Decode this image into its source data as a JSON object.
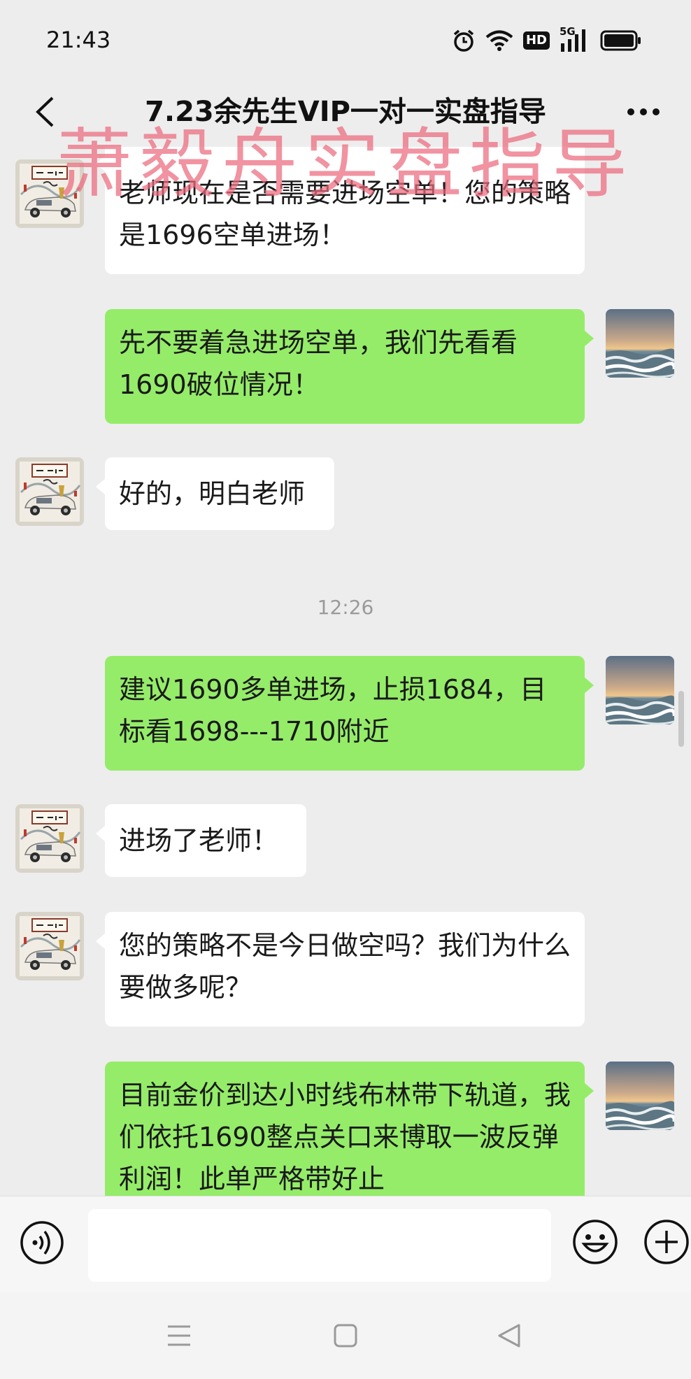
{
  "status_bar": {
    "time": "21:43",
    "icons": [
      "alarm-icon",
      "wifi-icon",
      "hd-icon",
      "signal-5g-icon",
      "battery-icon"
    ],
    "hd_label": "HD",
    "network_label": "5G"
  },
  "header": {
    "title": "7.23余先生VIP一对一实盘指导",
    "back_icon": "back-arrow-icon",
    "more_icon": "more-dots-icon"
  },
  "watermark": {
    "text": "萧毅舟实盘指导",
    "color": "#eb697d"
  },
  "messages": [
    {
      "side": "left",
      "avatar": "car-painting-avatar",
      "text": "老师现在是否需要进场空单！您的策略是1696空单进场！"
    },
    {
      "side": "right",
      "avatar": "sea-sunset-avatar",
      "text": "先不要着急进场空单，我们先看看1690破位情况！"
    },
    {
      "side": "left",
      "avatar": "car-painting-avatar",
      "text": "好的，明白老师"
    },
    {
      "type": "time",
      "text": "12:26"
    },
    {
      "side": "right",
      "avatar": "sea-sunset-avatar",
      "text": "建议1690多单进场，止损1684，目标看1698---1710附近"
    },
    {
      "side": "left",
      "avatar": "car-painting-avatar",
      "text": "进场了老师！"
    },
    {
      "side": "left",
      "avatar": "car-painting-avatar",
      "text": "您的策略不是今日做空吗？我们为什么要做多呢？"
    },
    {
      "side": "right",
      "avatar": "sea-sunset-avatar",
      "text": "目前金价到达小时线布林带下轨道，我们依托1690整点关口来博取一波反弹利润！此单严格带好止"
    }
  ],
  "input_bar": {
    "voice_icon": "voice-icon",
    "input_value": "",
    "emoji_icon": "emoji-icon",
    "plus_icon": "plus-icon"
  },
  "system_nav": {
    "icons": [
      "menu-lines-icon",
      "home-square-icon",
      "back-triangle-icon"
    ]
  },
  "colors": {
    "background": "#ededed",
    "bubble_self": "#95ec69",
    "bubble_other": "#ffffff"
  }
}
